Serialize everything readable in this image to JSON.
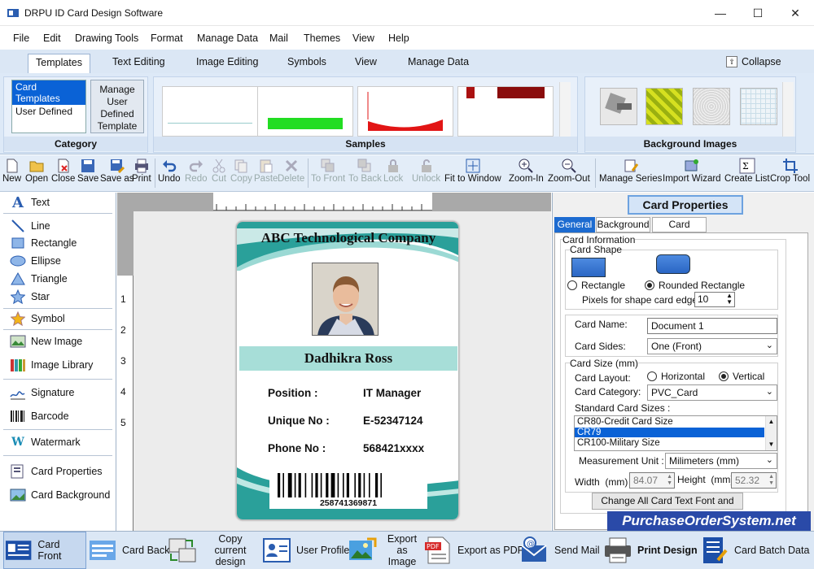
{
  "window": {
    "title": "DRPU ID Card Design Software"
  },
  "menu": [
    "File",
    "Edit",
    "Drawing Tools",
    "Format",
    "Manage Data",
    "Mail",
    "Themes",
    "View",
    "Help"
  ],
  "ribbon": {
    "tabs": [
      "Templates",
      "Text Editing",
      "Image Editing",
      "Symbols",
      "View",
      "Manage Data"
    ],
    "collapse": "Collapse",
    "category": {
      "items": [
        "Card Templates",
        "User Defined"
      ],
      "button": "Manage User Defined Template",
      "label": "Category"
    },
    "samples_label": "Samples",
    "background_label": "Background Images"
  },
  "toolbar": [
    "New",
    "Open",
    "Close",
    "Save",
    "Save as",
    "Print",
    "Undo",
    "Redo",
    "Cut",
    "Copy",
    "Paste",
    "Delete",
    "To Front",
    "To Back",
    "Lock",
    "Unlock",
    "Fit to Window",
    "Zoom-In",
    "Zoom-Out",
    "Manage Series",
    "Import Wizard",
    "Create List",
    "Crop Tool"
  ],
  "tools": [
    "Text",
    "Line",
    "Rectangle",
    "Ellipse",
    "Triangle",
    "Star",
    "Symbol",
    "New Image",
    "Image Library",
    "Signature",
    "Barcode",
    "Watermark",
    "Card Properties",
    "Card Background"
  ],
  "ruler": {
    "v": [
      "1",
      "2",
      "3",
      "4",
      "5"
    ]
  },
  "card": {
    "company": "ABC Technological Company",
    "name": "Dadhikra Ross",
    "rows": [
      {
        "label": "Position :",
        "value": "IT Manager"
      },
      {
        "label": "Unique No :",
        "value": "E-52347124"
      },
      {
        "label": "Phone No :",
        "value": "568421xxxx"
      }
    ],
    "barcode": "258741369871"
  },
  "props": {
    "title": "Card Properties",
    "tabs": [
      "General",
      "Background",
      "Card Border"
    ],
    "card_information": "Card Information",
    "card_shape": "Card Shape",
    "shape_rect": "Rectangle",
    "shape_round": "Rounded Rectangle",
    "edge_label": "Pixels for shape card edge :",
    "edge_value": "10",
    "card_name_label": "Card Name:",
    "card_name": "Document 1",
    "card_sides_label": "Card Sides:",
    "card_sides": "One (Front)",
    "card_size": "Card Size (mm)",
    "layout_label": "Card Layout:",
    "layout_h": "Horizontal",
    "layout_v": "Vertical",
    "category_label": "Card Category:",
    "category": "PVC_Card",
    "std_sizes_label": "Standard Card Sizes :",
    "std_sizes": [
      "CR80-Credit Card Size",
      "CR79",
      "CR100-Military Size"
    ],
    "unit_label": "Measurement Unit :",
    "unit": "Milimeters (mm)",
    "width_label": "Width",
    "width_unit": "(mm)",
    "width": "84.07",
    "height_label": "Height",
    "height_unit": "(mm)",
    "height": "52.32",
    "change_font": "Change All Card Text Font and Color"
  },
  "watermark": "PurchaseOrderSystem.net",
  "bottom": [
    "Card Front",
    "Card Back",
    "Copy current design",
    "User Profile",
    "Export as Image",
    "Export as PDF",
    "Send Mail",
    "Print Design",
    "Card Batch Data"
  ]
}
